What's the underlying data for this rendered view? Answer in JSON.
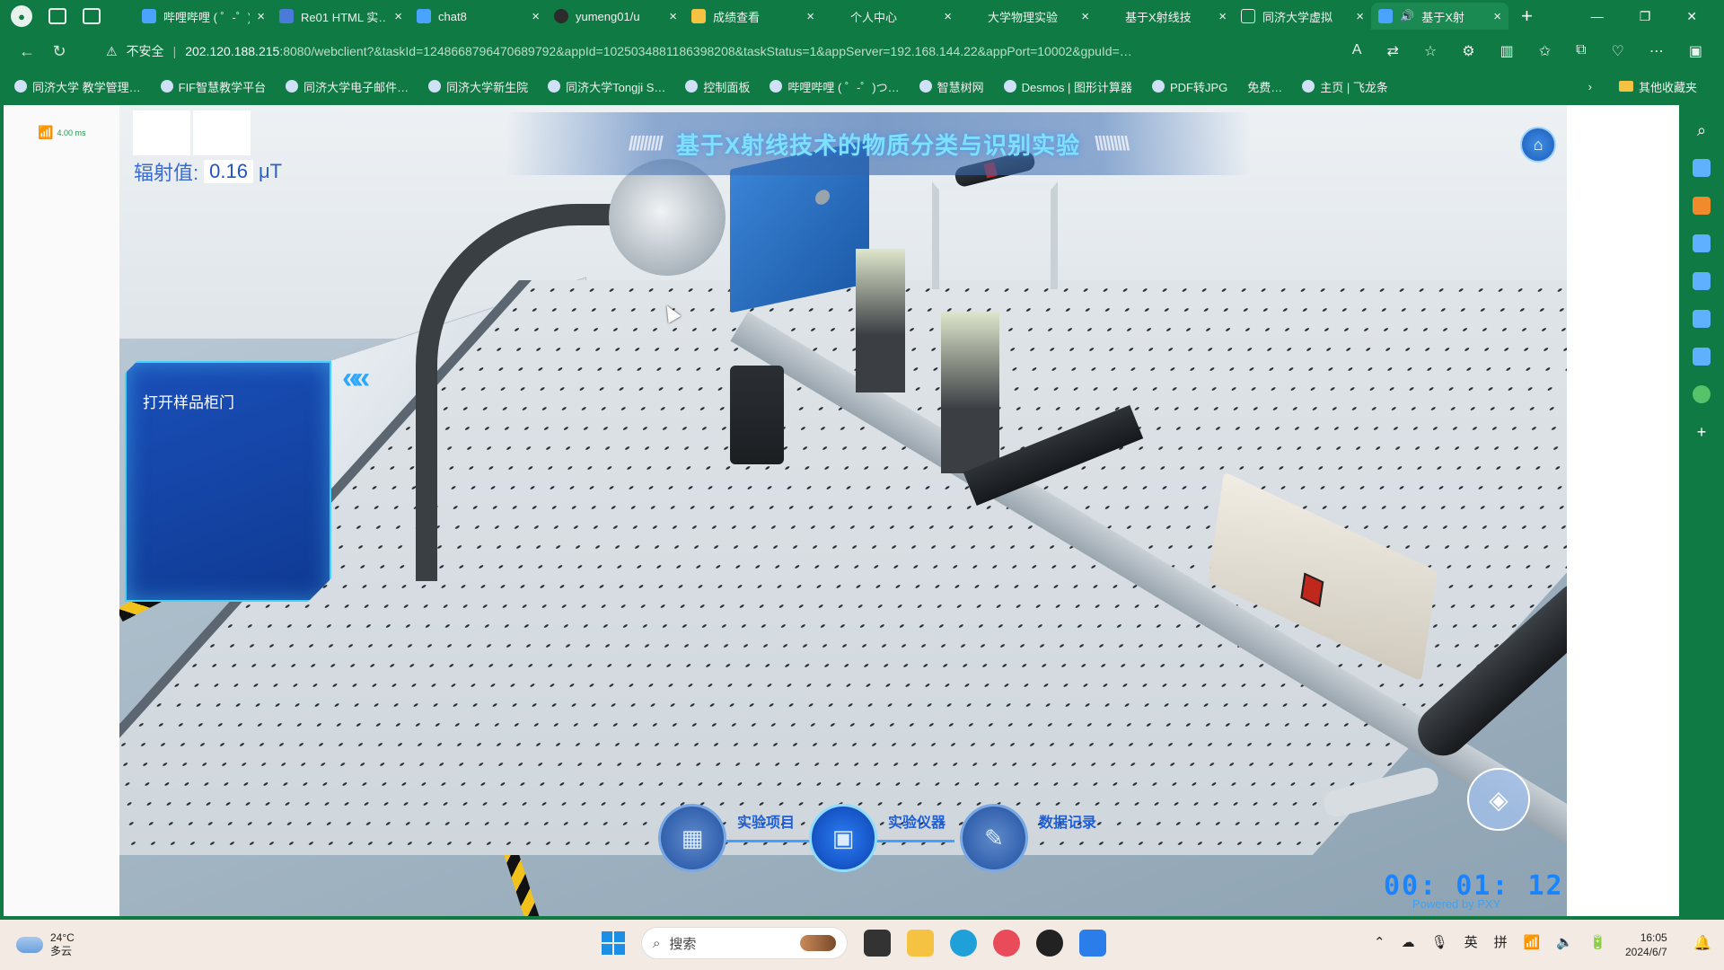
{
  "browser": {
    "tabs": [
      {
        "title": "哔哩哔哩 ( ゜-゜)",
        "fav": "bilibili-icon"
      },
      {
        "title": "Re01 HTML 实…",
        "fav": "doc-icon"
      },
      {
        "title": "chat8",
        "fav": "chat-icon"
      },
      {
        "title": "yumeng01/u",
        "fav": "github-icon"
      },
      {
        "title": "成绩查看",
        "fav": "page-icon"
      },
      {
        "title": "个人中心",
        "fav": "none"
      },
      {
        "title": "大学物理实验",
        "fav": "none"
      },
      {
        "title": "基于X射线技",
        "fav": "none"
      },
      {
        "title": "同济大学虚拟",
        "fav": "doc-icon"
      },
      {
        "title": "基于X射",
        "fav": "app-icon",
        "active": true
      }
    ],
    "new_tab": "+",
    "address": {
      "warning": "不安全",
      "host": "202.120.188.215",
      "path": ":8080/webclient?&taskId=1248668796470689792&appId=1025034881186398208&taskStatus=1&appServer=192.168.144.22&appPort=10002&gpuId=…"
    },
    "bookmarks": [
      "同济大学 教学管理…",
      "FIF智慧教学平台",
      "同济大学电子邮件…",
      "同济大学新生院",
      "同济大学Tongji S…",
      "控制面板",
      "哔哩哔哩 ( ゜-゜)つ…",
      "智慧树网",
      "Desmos | 图形计算器",
      "PDF转JPG",
      "免费…",
      "主页 | 飞龙条"
    ],
    "other_bookmarks": "其他收藏夹"
  },
  "app": {
    "network": "4.00 ms",
    "title": "基于X射线技术的物质分类与识别实验",
    "radiation_label": "辐射值:",
    "radiation_value": "0.16",
    "radiation_unit": "μT",
    "side_panel_item": "打开样品柜门",
    "nav": [
      {
        "label": "实验项目",
        "icon": "grid-icon"
      },
      {
        "label": "实验仪器",
        "icon": "monitor-icon",
        "active": true
      },
      {
        "label": "数据记录",
        "icon": "notes-icon"
      }
    ],
    "timer": "00: 01: 12",
    "powered": "Powered by PXY"
  },
  "taskbar": {
    "weather_temp": "24°C",
    "weather_desc": "多云",
    "search_placeholder": "搜索",
    "tray_lang": "英",
    "tray_ime": "拼",
    "time": "16:05",
    "date": "2024/6/7"
  }
}
